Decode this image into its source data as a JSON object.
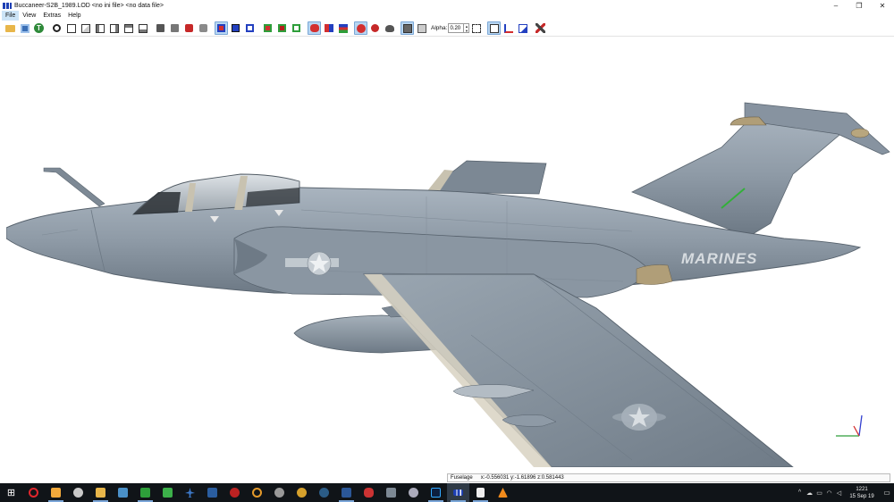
{
  "window": {
    "title": "Buccaneer-S2B_1989.LOD  <no ini file>  <no data file>",
    "minimize": "–",
    "maximize": "❐",
    "close": "✕"
  },
  "menu": [
    {
      "label": "File"
    },
    {
      "label": "View"
    },
    {
      "label": "Extras"
    },
    {
      "label": "Help"
    }
  ],
  "toolbar": {
    "alpha_label": "Alpha:",
    "alpha_value": "0.20",
    "spin_up": "▲",
    "spin_down": "▼"
  },
  "model": {
    "marking_text": "MARINES",
    "colors": {
      "fuselage": "#8e9aa6",
      "fuselage_shadow": "#6f7b87",
      "canopy": "#c9ced2",
      "background": "#ffffff"
    }
  },
  "status": {
    "part_name": "Fuselage",
    "coords": "x:-0.556031 y:-1.61896 z:0.581443"
  },
  "taskbar": {
    "start_glyph": "⊞",
    "clock_time": "1221",
    "clock_date": "15 Sep 19",
    "tray_chevron": "^",
    "notifications_glyph": "▭"
  }
}
